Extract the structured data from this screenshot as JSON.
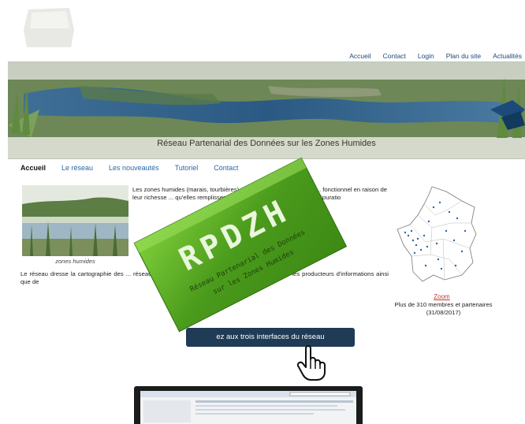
{
  "top_nav": [
    "Accueil",
    "Contact",
    "Login",
    "Plan du site",
    "Actualités"
  ],
  "banner_title": "Réseau Partenarial des Données sur les Zones Humides",
  "main_nav": [
    "Accueil",
    "Le réseau",
    "Les nouveautés",
    "Tutoriel",
    "Contact"
  ],
  "photo_caption": "zones humides",
  "intro_text": "Les zones humides (marais, tourbières), écosystèmes entre terre et ... fonctionnel en raison de leur richesse ... qu'elles remplissent. Elles ... et animales. Pa... dans l'épuratio",
  "para2_text": "Le réseau dresse la cartographie des ... réseau ainsi que des données s'y rapportant ... retrouver les producteurs d'informations ainsi que de",
  "zoom_link": "Zoom",
  "members_line1": "Plus de 310 membres et partenaires",
  "members_line2": "(31/08/2017)",
  "access_button": "ez aux trois interfaces du réseau",
  "overlay": {
    "logo_text": "RPDZH",
    "line1": "Réseau Partenarial des Données",
    "line2": "sur les Zones Humides",
    "color": "#4a9a1c"
  },
  "colors": {
    "nav_link": "#2a66a5",
    "top_nav": "#1c4a77",
    "button_bg": "#1f3b55",
    "zoom_link": "#c0392b"
  }
}
